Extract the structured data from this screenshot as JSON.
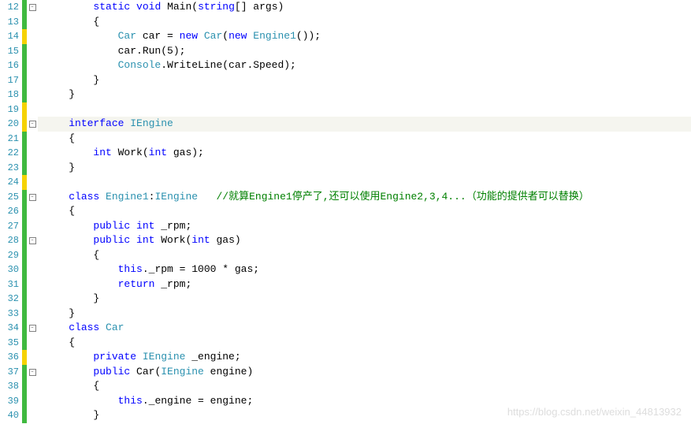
{
  "lines": [
    {
      "num": 12,
      "marker": "green",
      "fold": "minus",
      "tokens": [
        {
          "t": "plain",
          "v": "        "
        },
        {
          "t": "kw",
          "v": "static"
        },
        {
          "t": "plain",
          "v": " "
        },
        {
          "t": "kw",
          "v": "void"
        },
        {
          "t": "plain",
          "v": " Main("
        },
        {
          "t": "kw",
          "v": "string"
        },
        {
          "t": "plain",
          "v": "[] args)"
        }
      ]
    },
    {
      "num": 13,
      "marker": "green",
      "fold": "",
      "tokens": [
        {
          "t": "plain",
          "v": "        {"
        }
      ]
    },
    {
      "num": 14,
      "marker": "yellow",
      "fold": "",
      "tokens": [
        {
          "t": "plain",
          "v": "            "
        },
        {
          "t": "type",
          "v": "Car"
        },
        {
          "t": "plain",
          "v": " car = "
        },
        {
          "t": "kw",
          "v": "new"
        },
        {
          "t": "plain",
          "v": " "
        },
        {
          "t": "type",
          "v": "Car"
        },
        {
          "t": "plain",
          "v": "("
        },
        {
          "t": "kw",
          "v": "new"
        },
        {
          "t": "plain",
          "v": " "
        },
        {
          "t": "type",
          "v": "Engine1"
        },
        {
          "t": "plain",
          "v": "());"
        }
      ]
    },
    {
      "num": 15,
      "marker": "green",
      "fold": "",
      "tokens": [
        {
          "t": "plain",
          "v": "            car.Run(5);"
        }
      ]
    },
    {
      "num": 16,
      "marker": "green",
      "fold": "",
      "tokens": [
        {
          "t": "plain",
          "v": "            "
        },
        {
          "t": "type",
          "v": "Console"
        },
        {
          "t": "plain",
          "v": ".WriteLine(car.Speed);"
        }
      ]
    },
    {
      "num": 17,
      "marker": "green",
      "fold": "",
      "tokens": [
        {
          "t": "plain",
          "v": "        }"
        }
      ]
    },
    {
      "num": 18,
      "marker": "green",
      "fold": "",
      "tokens": [
        {
          "t": "plain",
          "v": "    }"
        }
      ]
    },
    {
      "num": 19,
      "marker": "yellow",
      "fold": "",
      "tokens": [
        {
          "t": "plain",
          "v": ""
        }
      ]
    },
    {
      "num": 20,
      "marker": "yellow",
      "fold": "minus",
      "highlight": true,
      "tokens": [
        {
          "t": "plain",
          "v": "    "
        },
        {
          "t": "kw",
          "v": "interface"
        },
        {
          "t": "plain",
          "v": " "
        },
        {
          "t": "type",
          "v": "IEngine"
        }
      ]
    },
    {
      "num": 21,
      "marker": "green",
      "fold": "",
      "tokens": [
        {
          "t": "plain",
          "v": "    {"
        }
      ]
    },
    {
      "num": 22,
      "marker": "green",
      "fold": "",
      "tokens": [
        {
          "t": "plain",
          "v": "        "
        },
        {
          "t": "kw",
          "v": "int"
        },
        {
          "t": "plain",
          "v": " Work("
        },
        {
          "t": "kw",
          "v": "int"
        },
        {
          "t": "plain",
          "v": " gas);"
        }
      ]
    },
    {
      "num": 23,
      "marker": "green",
      "fold": "",
      "tokens": [
        {
          "t": "plain",
          "v": "    }"
        }
      ]
    },
    {
      "num": 24,
      "marker": "yellow",
      "fold": "",
      "tokens": [
        {
          "t": "plain",
          "v": ""
        }
      ]
    },
    {
      "num": 25,
      "marker": "green",
      "fold": "minus",
      "tokens": [
        {
          "t": "plain",
          "v": "    "
        },
        {
          "t": "kw",
          "v": "class"
        },
        {
          "t": "plain",
          "v": " "
        },
        {
          "t": "type",
          "v": "Engine1"
        },
        {
          "t": "plain",
          "v": ":"
        },
        {
          "t": "type",
          "v": "IEngine"
        },
        {
          "t": "plain",
          "v": "   "
        },
        {
          "t": "comment",
          "v": "//就算Engine1停产了,还可以使用Engine2,3,4...（功能的提供者可以替换）"
        }
      ]
    },
    {
      "num": 26,
      "marker": "green",
      "fold": "",
      "tokens": [
        {
          "t": "plain",
          "v": "    {"
        }
      ]
    },
    {
      "num": 27,
      "marker": "green",
      "fold": "",
      "tokens": [
        {
          "t": "plain",
          "v": "        "
        },
        {
          "t": "kw",
          "v": "public"
        },
        {
          "t": "plain",
          "v": " "
        },
        {
          "t": "kw",
          "v": "int"
        },
        {
          "t": "plain",
          "v": " _rpm;"
        }
      ]
    },
    {
      "num": 28,
      "marker": "green",
      "fold": "minus",
      "tokens": [
        {
          "t": "plain",
          "v": "        "
        },
        {
          "t": "kw",
          "v": "public"
        },
        {
          "t": "plain",
          "v": " "
        },
        {
          "t": "kw",
          "v": "int"
        },
        {
          "t": "plain",
          "v": " Work("
        },
        {
          "t": "kw",
          "v": "int"
        },
        {
          "t": "plain",
          "v": " gas)"
        }
      ]
    },
    {
      "num": 29,
      "marker": "green",
      "fold": "",
      "tokens": [
        {
          "t": "plain",
          "v": "        {"
        }
      ]
    },
    {
      "num": 30,
      "marker": "green",
      "fold": "",
      "tokens": [
        {
          "t": "plain",
          "v": "            "
        },
        {
          "t": "kw",
          "v": "this"
        },
        {
          "t": "plain",
          "v": "._rpm = 1000 * gas;"
        }
      ]
    },
    {
      "num": 31,
      "marker": "green",
      "fold": "",
      "tokens": [
        {
          "t": "plain",
          "v": "            "
        },
        {
          "t": "kw",
          "v": "return"
        },
        {
          "t": "plain",
          "v": " _rpm;"
        }
      ]
    },
    {
      "num": 32,
      "marker": "green",
      "fold": "",
      "tokens": [
        {
          "t": "plain",
          "v": "        }"
        }
      ]
    },
    {
      "num": 33,
      "marker": "green",
      "fold": "",
      "tokens": [
        {
          "t": "plain",
          "v": "    }"
        }
      ]
    },
    {
      "num": 34,
      "marker": "green",
      "fold": "minus",
      "tokens": [
        {
          "t": "plain",
          "v": "    "
        },
        {
          "t": "kw",
          "v": "class"
        },
        {
          "t": "plain",
          "v": " "
        },
        {
          "t": "type",
          "v": "Car"
        }
      ]
    },
    {
      "num": 35,
      "marker": "green",
      "fold": "",
      "tokens": [
        {
          "t": "plain",
          "v": "    {"
        }
      ]
    },
    {
      "num": 36,
      "marker": "yellow",
      "fold": "",
      "tokens": [
        {
          "t": "plain",
          "v": "        "
        },
        {
          "t": "kw",
          "v": "private"
        },
        {
          "t": "plain",
          "v": " "
        },
        {
          "t": "type",
          "v": "IEngine"
        },
        {
          "t": "plain",
          "v": " _engine;"
        }
      ]
    },
    {
      "num": 37,
      "marker": "green",
      "fold": "minus",
      "tokens": [
        {
          "t": "plain",
          "v": "        "
        },
        {
          "t": "kw",
          "v": "public"
        },
        {
          "t": "plain",
          "v": " Car("
        },
        {
          "t": "type",
          "v": "IEngine"
        },
        {
          "t": "plain",
          "v": " engine)"
        }
      ]
    },
    {
      "num": 38,
      "marker": "green",
      "fold": "",
      "tokens": [
        {
          "t": "plain",
          "v": "        {"
        }
      ]
    },
    {
      "num": 39,
      "marker": "green",
      "fold": "",
      "tokens": [
        {
          "t": "plain",
          "v": "            "
        },
        {
          "t": "kw",
          "v": "this"
        },
        {
          "t": "plain",
          "v": "._engine = engine;"
        }
      ]
    },
    {
      "num": 40,
      "marker": "green",
      "fold": "",
      "tokens": [
        {
          "t": "plain",
          "v": "        }"
        }
      ]
    }
  ],
  "watermark": "https://blog.csdn.net/weixin_44813932"
}
